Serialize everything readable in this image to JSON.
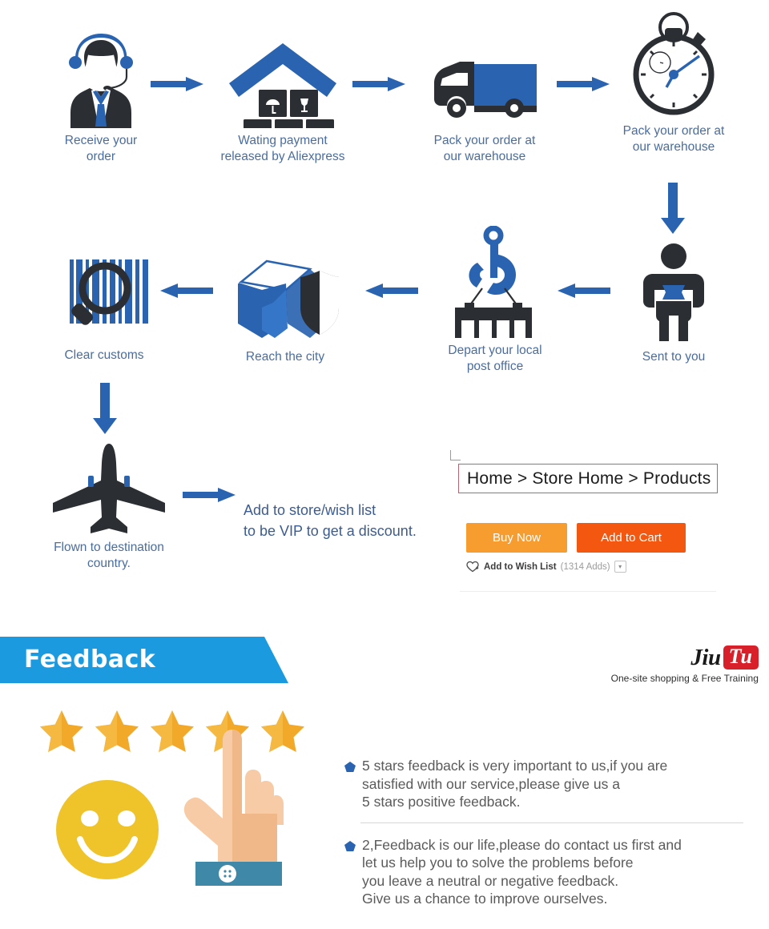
{
  "colors": {
    "flow_blue": "#2a64b0",
    "icon_dark": "#2b2f33",
    "label_blue": "#4a6d9e",
    "banner_blue": "#1b9ae0",
    "buy_now": "#f79c2e",
    "add_cart": "#f4570f",
    "logo_red": "#d8202a",
    "star_gold": "#f2a829",
    "smiley_yellow": "#efc32a",
    "hand_skin": "#f4c097",
    "cuff_teal": "#3f88a8",
    "crumb_border": "#b4656d"
  },
  "flow": {
    "steps": [
      {
        "id": "receive-order",
        "icon": "support-agent-icon",
        "label": "Receive your\norder"
      },
      {
        "id": "waiting-payment",
        "icon": "warehouse-boxes-icon",
        "label": "Wating payment\nreleased by Aliexpress"
      },
      {
        "id": "pack-truck",
        "icon": "delivery-truck-icon",
        "label": "Pack your order at\nour warehouse"
      },
      {
        "id": "pack-stopwatch",
        "icon": "stopwatch-icon",
        "label": "Pack your order at\nour warehouse"
      },
      {
        "id": "sent-to-you",
        "icon": "person-parcel-icon",
        "label": "Sent to you"
      },
      {
        "id": "depart-post",
        "icon": "crane-container-icon",
        "label": "Depart your local\npost office"
      },
      {
        "id": "reach-city",
        "icon": "box-shield-icon",
        "label": "Reach the city"
      },
      {
        "id": "clear-customs",
        "icon": "barcode-magnifier-icon",
        "label": "Clear customs"
      },
      {
        "id": "flown",
        "icon": "airplane-icon",
        "label": "Flown to destination\ncountry."
      }
    ],
    "promo": "Add to store/wish list\nto be VIP to get a discount."
  },
  "store": {
    "breadcrumb": "Home > Store Home > Products",
    "buy_now_label": "Buy Now",
    "add_to_cart_label": "Add to Cart",
    "wish_list_label": "Add to Wish List",
    "wish_list_count": "(1314 Adds)",
    "wish_icon": "heart-plus-icon",
    "caret_icon": "chevron-down-icon"
  },
  "feedback": {
    "banner_title": "Feedback",
    "stars_count": 5,
    "star_icon": "star-icon",
    "smiley_icon": "smiley-face-icon",
    "hand_icon": "pointing-hand-icon",
    "bullet_icon": "pentagon-bullet-icon",
    "items": [
      "5 stars feedback is very important to us,if you are\nsatisfied with our service,please give us a\n5 stars positive feedback.",
      "2,Feedback is our life,please do contact us first and\nlet us help you to solve the problems  before\nyou leave a neutral or negative feedback.\nGive us a chance to improve ourselves."
    ]
  },
  "logo": {
    "name_part1": "Jiu",
    "name_part2": "Tu",
    "tagline": "One-site shopping & Free Training"
  }
}
